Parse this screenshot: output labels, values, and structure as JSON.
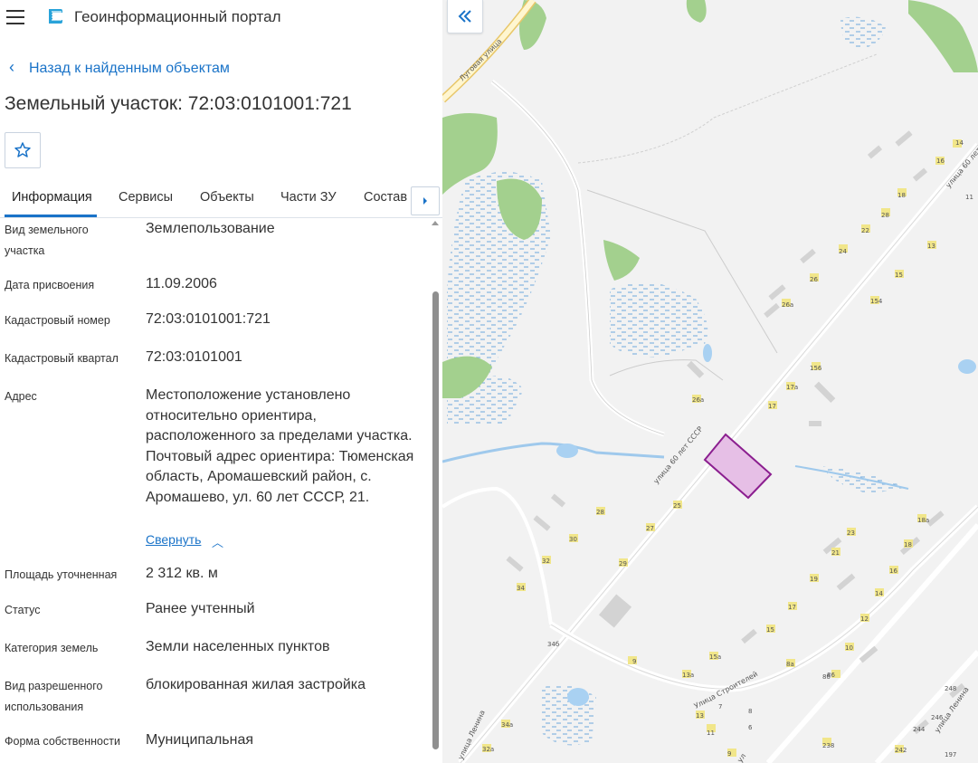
{
  "app": {
    "title": "Геоинформационный портал"
  },
  "nav": {
    "back_label": "Назад к найденным объектам"
  },
  "object": {
    "title": "Земельный участок: 72:03:0101001:721"
  },
  "tabs": [
    "Информация",
    "Сервисы",
    "Объекты",
    "Части ЗУ",
    "Состав"
  ],
  "properties": [
    {
      "label": "Вид земельного участка",
      "value": "Землепользование"
    },
    {
      "label": "Дата присвоения",
      "value": "11.09.2006"
    },
    {
      "label": "Кадастровый номер",
      "value": "72:03:0101001:721"
    },
    {
      "label": "Кадастровый квартал",
      "value": "72:03:0101001"
    },
    {
      "label": "Адрес",
      "value": "Местоположение установлено относительно ориентира, расположенного за пределами участка. Почтовый адрес ориентира: Тюменская область, Аромашевский район, с. Аромашево, ул. 60 лет СССР, 21."
    },
    {
      "label": "Площадь уточненная",
      "value": "2 312 кв. м"
    },
    {
      "label": "Статус",
      "value": "Ранее учтенный"
    },
    {
      "label": "Категория земель",
      "value": "Земли населенных пунктов"
    },
    {
      "label": "Вид разрешенного использования",
      "value": "блокированная жилая застройка"
    },
    {
      "label": "Форма собственности",
      "value": "Муниципальная"
    }
  ],
  "address_collapse_label": "Свернуть",
  "map": {
    "street_labels": [
      "Луговая улица",
      "улица 60 лет СССР",
      "Улица Строителей",
      "улица 60 лет",
      "улица Ленина",
      "улица Ленина",
      "ул"
    ],
    "house_numbers": [
      "14",
      "16",
      "18",
      "13",
      "11",
      "28",
      "22",
      "24",
      "26",
      "26а",
      "154",
      "15",
      "156",
      "17а",
      "17",
      "26а",
      "28",
      "30",
      "32",
      "34",
      "34б",
      "27",
      "25",
      "29",
      "23",
      "21",
      "19",
      "17",
      "15",
      "13",
      "9",
      "11",
      "8",
      "6",
      "13",
      "11",
      "7",
      "9",
      "8а",
      "8б",
      "10",
      "12",
      "14",
      "16",
      "18",
      "18а",
      "23",
      "15а",
      "13а",
      "238",
      "242",
      "244",
      "246",
      "248",
      "197",
      "32а",
      "34а",
      "15"
    ],
    "parcel_color": "#c77bc9"
  },
  "icons": {
    "menu": "hamburger-icon",
    "logo": "portal-logo-icon",
    "back": "chevron-left-icon",
    "favorite": "star-outline-icon",
    "tabs_next": "chevron-right-icon",
    "collapse_panel": "double-chevron-left-icon"
  }
}
